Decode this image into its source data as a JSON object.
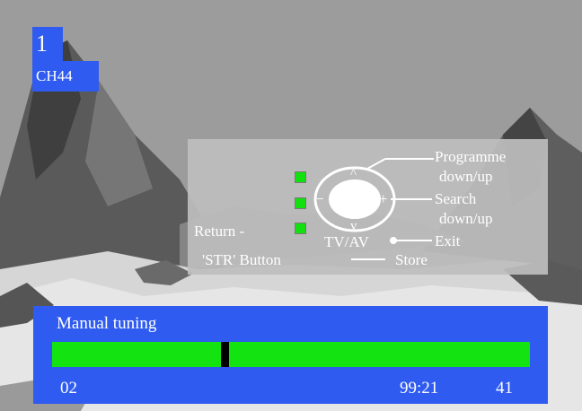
{
  "channel": {
    "number": "1",
    "name": "CH44"
  },
  "help": {
    "programme_line1": "Programme",
    "programme_line2": "down/up",
    "search_line1": "Search",
    "search_line2": "down/up",
    "return_label": "Return -",
    "tvav_label": "TV/AV",
    "exit_label": "Exit",
    "str_label": "'STR' Button",
    "store_label": "Store",
    "up_symbol": "^",
    "down_symbol": "v",
    "minus_symbol": "−",
    "plus_symbol": "+"
  },
  "tuning": {
    "title": "Manual tuning",
    "left_value": "02",
    "middle_value": "99:21",
    "right_value": "41",
    "progress": 0.36
  },
  "colors": {
    "osd_blue": "#2f5bf0",
    "progress_green": "#14e312",
    "indicator_green": "#12e00f"
  }
}
